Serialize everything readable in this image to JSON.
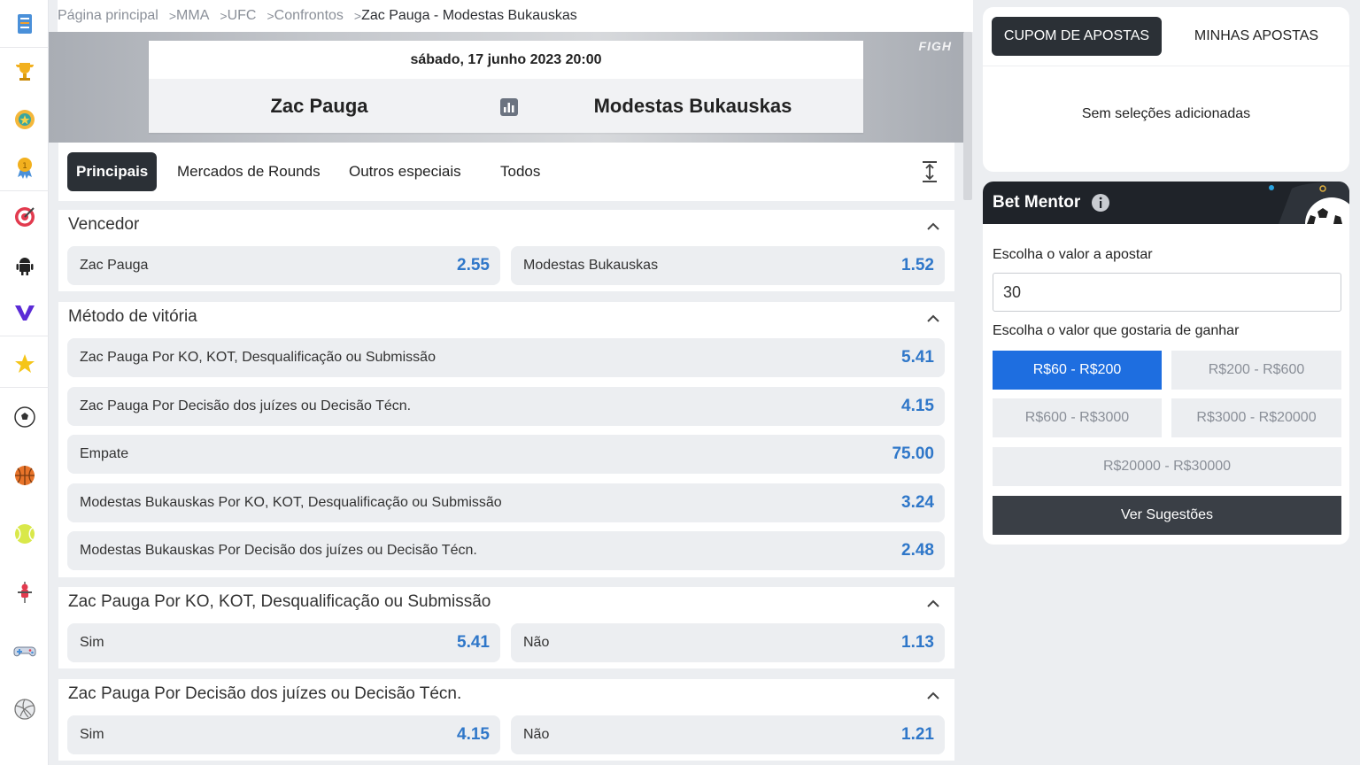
{
  "breadcrumb": {
    "items": [
      "Página principal",
      "MMA",
      "UFC",
      "Confrontos"
    ],
    "current": "Zac Pauga - Modestas Bukauskas"
  },
  "event": {
    "date": "sábado, 17 junho 2023 20:00",
    "fighter1": "Zac Pauga",
    "fighter2": "Modestas Bukauskas",
    "banner_text": "FIGH"
  },
  "tabs": [
    {
      "label": "Principais",
      "active": true
    },
    {
      "label": "Mercados de Rounds",
      "active": false
    },
    {
      "label": "Outros especiais",
      "active": false
    },
    {
      "label": "Todos",
      "active": false
    }
  ],
  "markets": {
    "vencedor": {
      "title": "Vencedor",
      "odds": [
        {
          "label": "Zac Pauga",
          "value": "2.55"
        },
        {
          "label": "Modestas Bukauskas",
          "value": "1.52"
        }
      ]
    },
    "metodo": {
      "title": "Método de vitória",
      "odds": [
        {
          "label": "Zac Pauga Por KO, KOT, Desqualificação ou Submissão",
          "value": "5.41"
        },
        {
          "label": "Zac Pauga Por Decisão dos juízes ou Decisão Técn.",
          "value": "4.15"
        },
        {
          "label": "Empate",
          "value": "75.00"
        },
        {
          "label": "Modestas Bukauskas Por KO, KOT, Desqualificação ou Submissão",
          "value": "3.24"
        },
        {
          "label": "Modestas Bukauskas Por Decisão dos juízes ou Decisão Técn.",
          "value": "2.48"
        }
      ]
    },
    "zac_ko": {
      "title": "Zac Pauga Por KO, KOT, Desqualificação ou Submissão",
      "odds": [
        {
          "label": "Sim",
          "value": "5.41"
        },
        {
          "label": "Não",
          "value": "1.13"
        }
      ]
    },
    "zac_decisao": {
      "title": "Zac Pauga Por Decisão dos juízes ou Decisão Técn.",
      "odds": [
        {
          "label": "Sim",
          "value": "4.15"
        },
        {
          "label": "Não",
          "value": "1.21"
        }
      ]
    }
  },
  "coupon": {
    "tab_active": "CUPOM DE APOSTAS",
    "tab_other": "MINHAS APOSTAS",
    "empty_text": "Sem seleções adicionadas"
  },
  "mentor": {
    "title": "Bet Mentor",
    "stake_label": "Escolha o valor a apostar",
    "stake_value": "30",
    "win_label": "Escolha o valor que gostaria de ganhar",
    "ranges": [
      "R$60 - R$200",
      "R$200 - R$600",
      "R$600 - R$3000",
      "R$3000 - R$20000",
      "R$20000 - R$30000"
    ],
    "selected_range": "R$60 - R$200",
    "button": "Ver Sugestões"
  },
  "rail_icons": [
    "betslip-icon",
    "trophy-icon",
    "star-badge-icon",
    "medal-icon",
    "target-icon",
    "android-icon",
    "v-logo-icon",
    "favorites-star-icon",
    "soccer-icon",
    "basketball-icon",
    "tennis-icon",
    "table-football-icon",
    "gamepad-icon",
    "volleyball-icon"
  ],
  "colors": {
    "odd_value": "#2f77c9",
    "dark": "#2b3036",
    "selected": "#1e6ee0"
  }
}
